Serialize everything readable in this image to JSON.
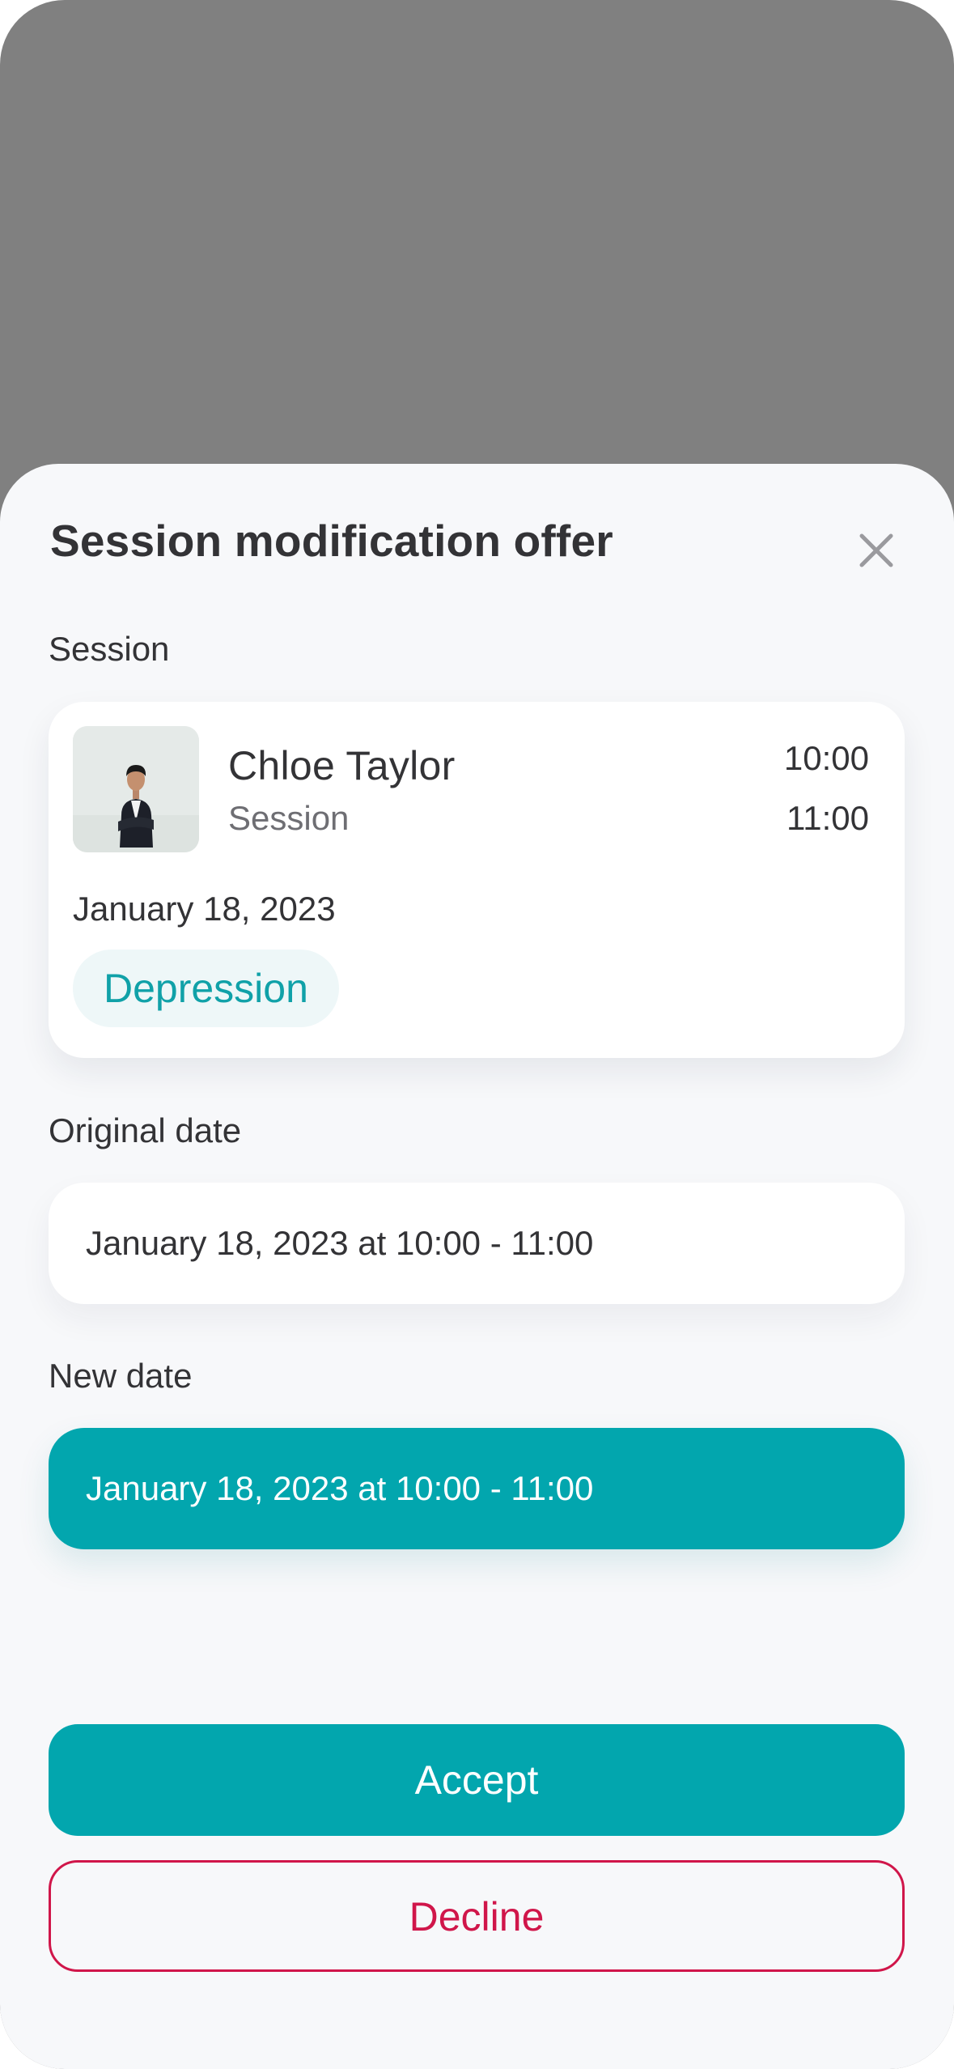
{
  "sheet": {
    "title": "Session modification offer",
    "close_icon": "close-icon"
  },
  "session": {
    "label": "Session",
    "person_name": "Chloe Taylor",
    "type": "Session",
    "start_time": "10:00",
    "end_time": "11:00",
    "date": "January 18, 2023",
    "tag": "Depression"
  },
  "original_date": {
    "label": "Original date",
    "value": "January 18, 2023 at 10:00 - 11:00"
  },
  "new_date": {
    "label": "New date",
    "value": "January 18, 2023 at 10:00 - 11:00"
  },
  "actions": {
    "accept_label": "Accept",
    "decline_label": "Decline"
  },
  "colors": {
    "accent": "#02a6ae",
    "decline": "#d0164a",
    "overlay": "#808080",
    "sheet_background": "#f7f8fa"
  }
}
